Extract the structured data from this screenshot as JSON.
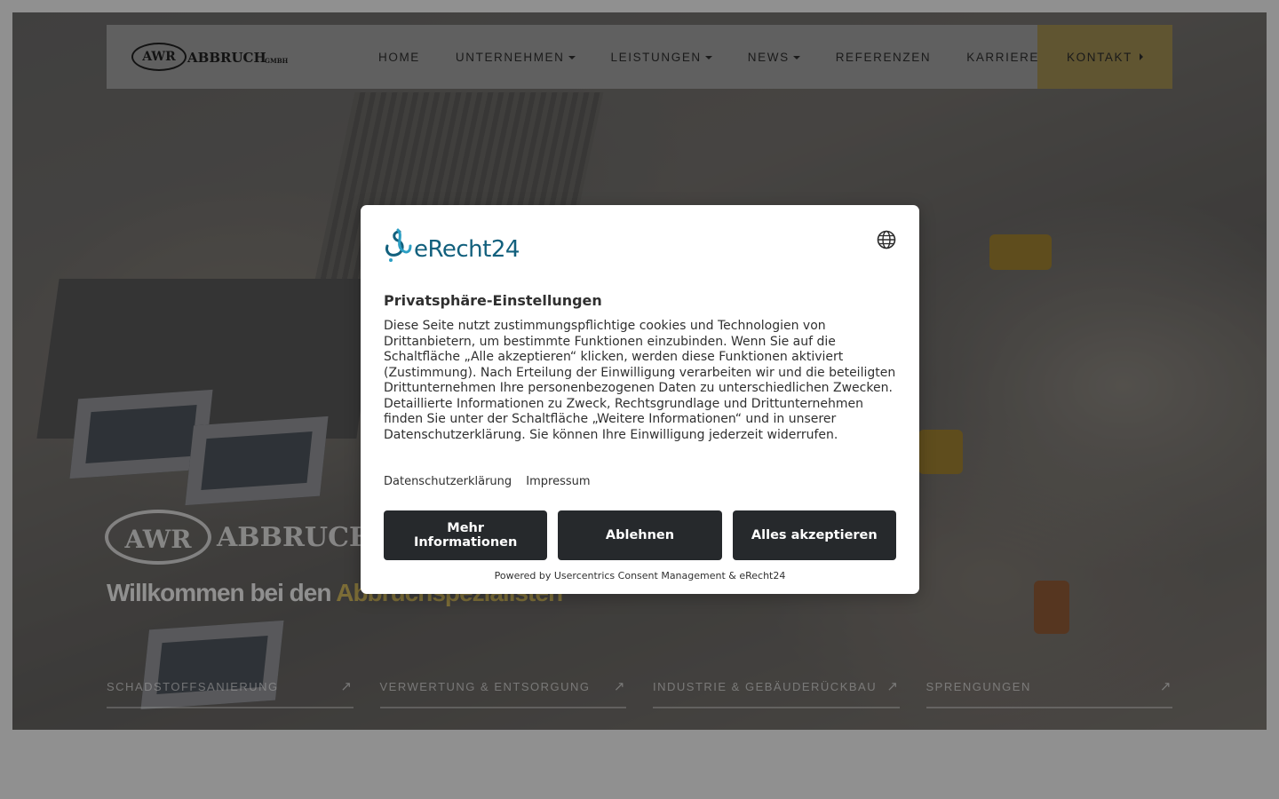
{
  "header": {
    "brand": {
      "ring": "AWR",
      "word": "ABBRUCH",
      "suffix": "GMBH"
    },
    "nav": [
      {
        "label": "HOME",
        "dropdown": false
      },
      {
        "label": "UNTERNEHMEN",
        "dropdown": true
      },
      {
        "label": "LEISTUNGEN",
        "dropdown": true
      },
      {
        "label": "NEWS",
        "dropdown": true
      },
      {
        "label": "REFERENZEN",
        "dropdown": false
      },
      {
        "label": "KARRIERE",
        "dropdown": false
      }
    ],
    "contact_label": "KONTAKT"
  },
  "hero": {
    "logo": {
      "ring": "AWR",
      "word": "ABBRUCH"
    },
    "title_prefix": "Willkommen bei den",
    "title_accent": "Abbruchspezialisten",
    "services": [
      {
        "label": "SCHADSTOFFSANIERUNG",
        "icon": "arrow-up-right-icon"
      },
      {
        "label": "VERWERTUNG & ENTSORGUNG",
        "icon": "arrow-up-right-icon"
      },
      {
        "label": "INDUSTRIE & GEBÄUDERÜCKBAU",
        "icon": "arrow-up-right-icon"
      },
      {
        "label": "SPRENGUNGEN",
        "icon": "arrow-up-right-icon"
      }
    ]
  },
  "consent": {
    "logo_text": "eRecht24",
    "title": "Privatsphäre-Einstellungen",
    "body": "Diese Seite nutzt zustimmungspflichtige cookies und Technologien von Drittanbietern, um bestimmte Funktionen einzubinden. Wenn Sie auf die Schaltfläche „Alle akzeptieren“ klicken, werden diese Funktionen aktiviert (Zustimmung). Nach Erteilung der Einwilligung verarbeiten wir und die beteiligten Drittunternehmen Ihre personenbezogenen Daten zu unterschiedlichen Zwecken. Detaillierte Informationen zu Zweck, Rechtsgrundlage und Drittunternehmen finden Sie unter der Schaltfläche „Weitere Informationen“ und in unserer Datenschutzerklärung. Sie können Ihre Einwilligung jederzeit widerrufen.",
    "links": [
      "Datenschutzerklärung",
      "Impressum"
    ],
    "buttons": {
      "more": "Mehr Informationen",
      "deny": "Ablehnen",
      "accept": "Alles akzeptieren"
    },
    "powered_by": "Powered by Usercentrics Consent Management & eRecht24"
  },
  "colors": {
    "accent": "#e8c45a",
    "button_bg": "#26292c",
    "erecht_blue": "#12607d"
  }
}
